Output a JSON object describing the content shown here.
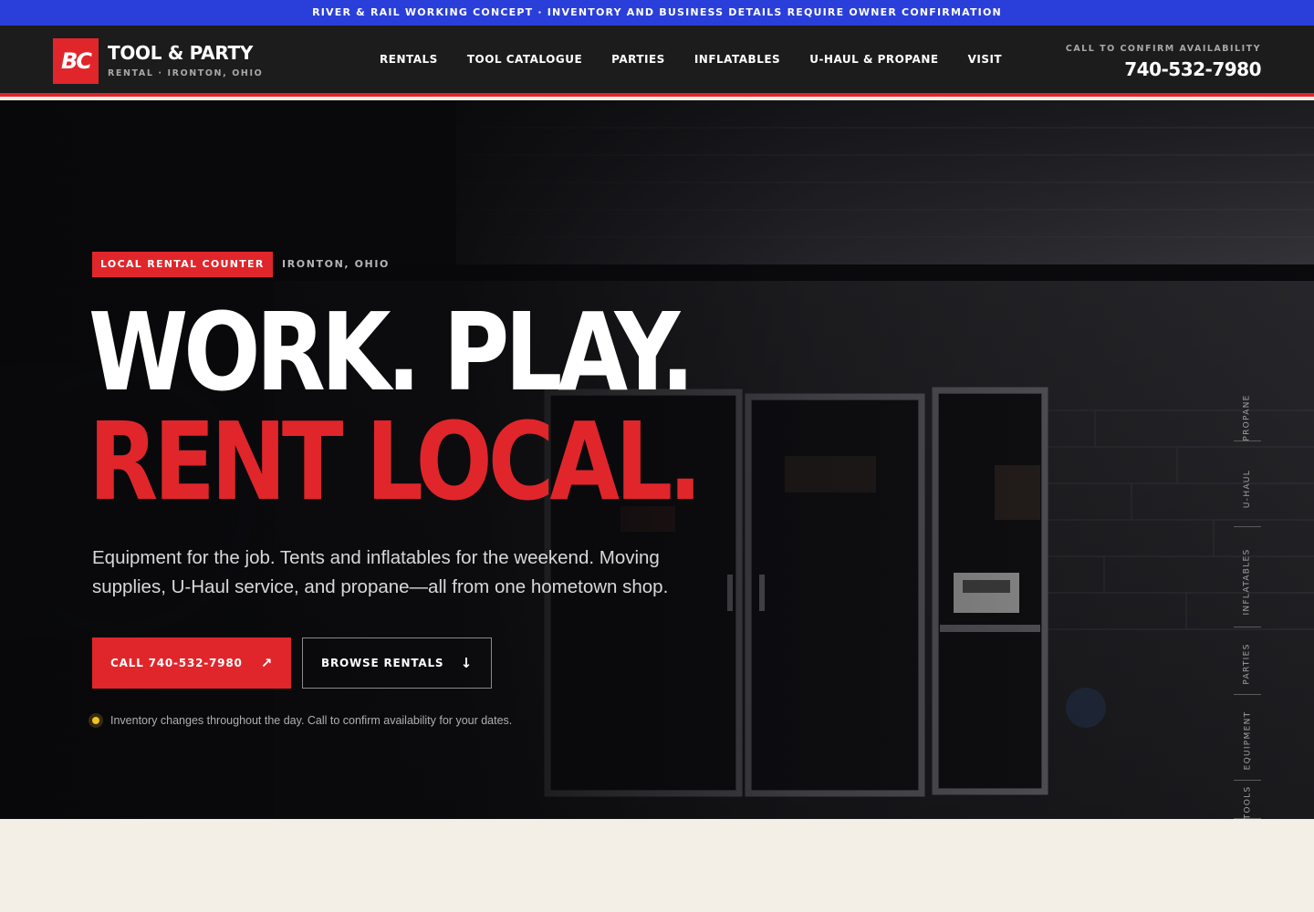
{
  "banner": {
    "text": "RIVER & RAIL WORKING CONCEPT · INVENTORY AND BUSINESS DETAILS REQUIRE OWNER CONFIRMATION"
  },
  "brand": {
    "mark": "BC",
    "title": "TOOL & PARTY",
    "subtitle": "RENTAL · IRONTON, OHIO"
  },
  "nav": {
    "items": [
      "RENTALS",
      "TOOL CATALOGUE",
      "PARTIES",
      "INFLATABLES",
      "U-HAUL & PROPANE",
      "VISIT"
    ]
  },
  "header_cta": {
    "label": "CALL TO CONFIRM AVAILABILITY",
    "phone": "740-532-7980"
  },
  "hero": {
    "tag": "LOCAL RENTAL COUNTER",
    "location": "IRONTON, OHIO",
    "headline_1": "WORK. PLAY.",
    "headline_2": "RENT LOCAL.",
    "lede": "Equipment for the job. Tents and inflatables for the weekend. Moving supplies, U-Haul service, and propane—all from one hometown shop.",
    "call_button": "CALL 740-532-7980",
    "browse_button": "BROWSE RENTALS",
    "note": "Inventory changes throughout the day. Call to confirm availability for your dates."
  },
  "side_nav": {
    "items": [
      "PROPANE",
      "U-HAUL",
      "INFLATABLES",
      "PARTIES",
      "EQUIPMENT",
      "TOOLS"
    ]
  },
  "icons": {
    "call": "arrow-up-right-icon",
    "browse": "arrow-down-icon",
    "note": "status-dot-icon"
  },
  "colors": {
    "accent": "#e0262b",
    "banner": "#2a3fd9",
    "header": "#1c1c1c",
    "page": "#f4efe6",
    "status": "#f5c21b"
  }
}
